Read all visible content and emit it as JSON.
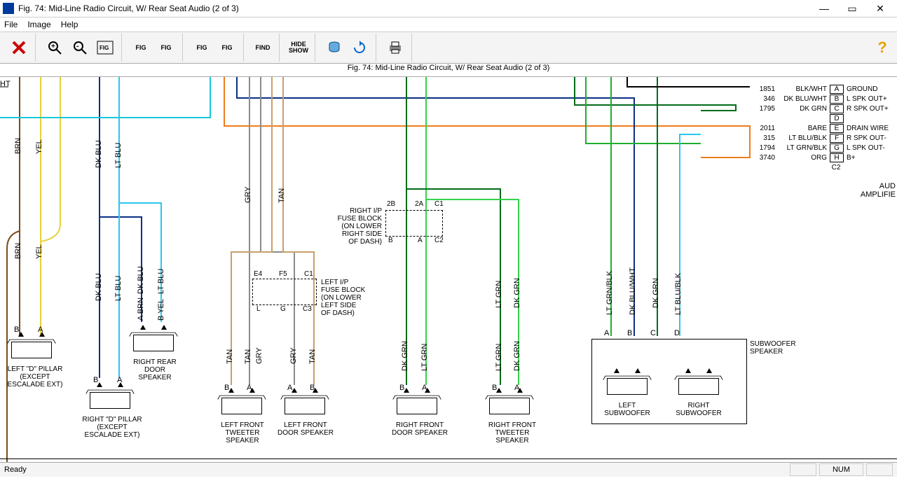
{
  "window": {
    "title": "Fig. 74: Mid-Line Radio Circuit, W/ Rear Seat Audio (2 of 3)",
    "subtitle": "Fig. 74: Mid-Line Radio Circuit, W/ Rear Seat Audio (2 of 3)"
  },
  "menu": {
    "file": "File",
    "image": "Image",
    "help": "Help"
  },
  "toolbar": {
    "fig": "FIG",
    "find": "FIND",
    "hide": "HIDE",
    "show": "SHOW"
  },
  "status": {
    "ready": "Ready",
    "num": "NUM"
  },
  "connector": {
    "rows": [
      {
        "num": "1851",
        "color": "BLK/WHT",
        "pin": "A",
        "sig": "GROUND"
      },
      {
        "num": "346",
        "color": "DK BLU/WHT",
        "pin": "B",
        "sig": "L SPK OUT+"
      },
      {
        "num": "1795",
        "color": "DK GRN",
        "pin": "C",
        "sig": "R SPK OUT+"
      },
      {
        "num": "",
        "color": "",
        "pin": "D",
        "sig": ""
      },
      {
        "num": "2011",
        "color": "BARE",
        "pin": "E",
        "sig": "DRAIN WIRE"
      },
      {
        "num": "315",
        "color": "LT BLU/BLK",
        "pin": "F",
        "sig": "R SPK OUT-"
      },
      {
        "num": "1794",
        "color": "LT GRN/BLK",
        "pin": "G",
        "sig": "L SPK OUT-"
      },
      {
        "num": "3740",
        "color": "ORG",
        "pin": "H",
        "sig": "B+"
      }
    ],
    "conn_id": "C2",
    "module": "AUD\nAMPLIFIE"
  },
  "fuse_right": {
    "label": "RIGHT I/P\nFUSE BLOCK\n(ON LOWER\nRIGHT SIDE\nOF DASH)",
    "tl": "2B",
    "tr": "2A",
    "tr2": "C1",
    "bl": "B",
    "br": "A",
    "br2": "C2"
  },
  "fuse_left": {
    "label": "LEFT I/P\nFUSE BLOCK\n(ON LOWER\nLEFT SIDE\nOF DASH)",
    "tl": "E4",
    "tm": "F5",
    "tr": "C1",
    "bl": "L",
    "bm": "G",
    "br": "C3"
  },
  "speakers": {
    "left_d": "LEFT \"D\" PILLAR\n(EXCEPT\nESCALADE EXT)",
    "right_d": "RIGHT \"D\" PILLAR\n(EXCEPT\nESCALADE EXT)",
    "rr_door": "RIGHT REAR\nDOOR\nSPEAKER",
    "lf_tweet": "LEFT FRONT\nTWEETER\nSPEAKER",
    "lf_door": "LEFT FRONT\nDOOR SPEAKER",
    "rf_door": "RIGHT FRONT\nDOOR SPEAKER",
    "rf_tweet": "RIGHT FRONT\nTWEETER\nSPEAKER",
    "l_sub": "LEFT\nSUBWOOFER",
    "r_sub": "RIGHT\nSUBWOOFER",
    "sub_enc": "SUBWOOFER\nSPEAKER"
  },
  "wires": {
    "brn": "BRN",
    "yel": "YEL",
    "dkblu": "DK BLU",
    "ltblu": "LT BLU",
    "abrn": "A BRN",
    "byel": "B YEL",
    "tan": "TAN",
    "gry": "GRY",
    "dkgrn": "DK GRN",
    "ltgrn": "LT GRN",
    "ltgrnblk": "LT GRN/BLK",
    "dkbluwht": "DK BLU/WHT",
    "ltblublk": "LT BLU/BLK"
  },
  "pins": {
    "a": "A",
    "b": "B",
    "c": "C",
    "d": "D"
  }
}
